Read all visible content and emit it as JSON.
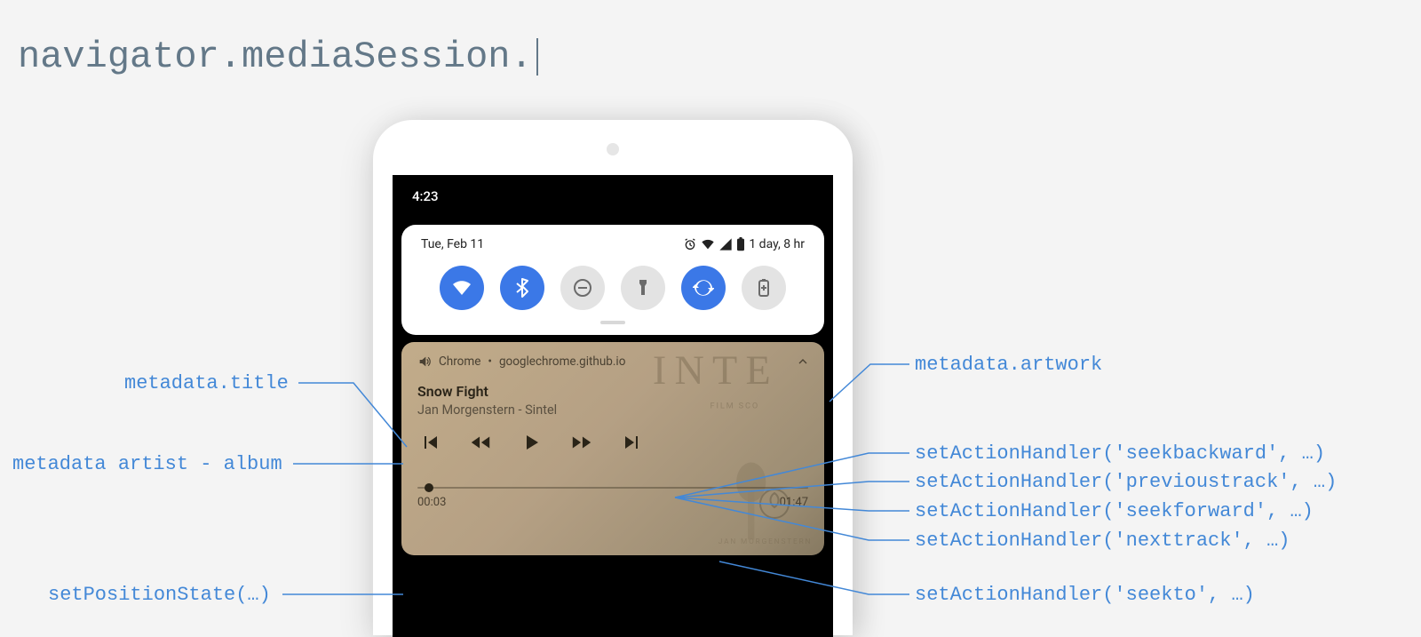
{
  "header": {
    "code": "navigator.mediaSession."
  },
  "statusbar": {
    "time": "4:23"
  },
  "quick_settings": {
    "date": "Tue, Feb 11",
    "battery_remaining": "1 day, 8 hr",
    "tiles": [
      "wifi",
      "bluetooth",
      "dnd",
      "flashlight",
      "rotate",
      "battery-saver"
    ]
  },
  "media": {
    "source_app": "Chrome",
    "source_host": "googlechrome.github.io",
    "title": "Snow Fight",
    "subtitle": "Jan Morgenstern - Sintel",
    "time_elapsed": "00:03",
    "time_total": "01:47"
  },
  "annotations": {
    "title": "metadata.title",
    "artist_album": "metadata artist - album",
    "position_state": "setPositionState(…)",
    "artwork": "metadata.artwork",
    "seekbackward": "setActionHandler('seekbackward', …)",
    "previoustrack": "setActionHandler('previoustrack', …)",
    "seekforward": "setActionHandler('seekforward', …)",
    "nexttrack": "setActionHandler('nexttrack', …)",
    "seekto": "setActionHandler('seekto', …)"
  }
}
